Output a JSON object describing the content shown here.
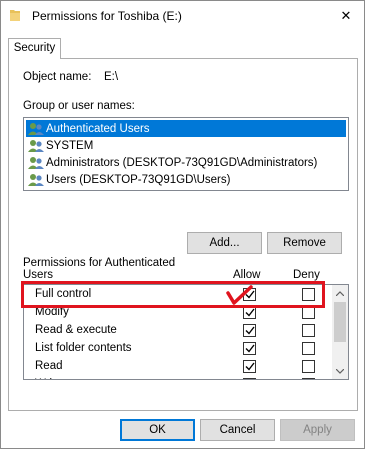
{
  "window": {
    "title": "Permissions for Toshiba (E:)",
    "close_glyph": "✕"
  },
  "tabs": [
    {
      "label": "Security"
    }
  ],
  "object": {
    "label": "Object name:",
    "value": "E:\\"
  },
  "groups": {
    "label": "Group or user names:",
    "items": [
      {
        "name": "Authenticated Users",
        "selected": true
      },
      {
        "name": "SYSTEM",
        "selected": false
      },
      {
        "name": "Administrators (DESKTOP-73Q91GD\\Administrators)",
        "selected": false
      },
      {
        "name": "Users (DESKTOP-73Q91GD\\Users)",
        "selected": false
      }
    ]
  },
  "buttons": {
    "add": "Add...",
    "remove": "Remove",
    "ok": "OK",
    "cancel": "Cancel",
    "apply": "Apply"
  },
  "permissions": {
    "label_line1": "Permissions for Authenticated",
    "label_line2": "Users",
    "allow_header": "Allow",
    "deny_header": "Deny",
    "rows": [
      {
        "name": "Full control",
        "allow": true,
        "deny": false
      },
      {
        "name": "Modify",
        "allow": true,
        "deny": false
      },
      {
        "name": "Read & execute",
        "allow": true,
        "deny": false
      },
      {
        "name": "List folder contents",
        "allow": true,
        "deny": false
      },
      {
        "name": "Read",
        "allow": true,
        "deny": false
      },
      {
        "name": "Write",
        "allow": true,
        "deny": false
      }
    ]
  },
  "colors": {
    "selection": "#0078d7",
    "annotation": "#e0141e"
  },
  "icons": {
    "title": "folder-icon",
    "user": "users-icon",
    "check": "checkmark-icon"
  }
}
